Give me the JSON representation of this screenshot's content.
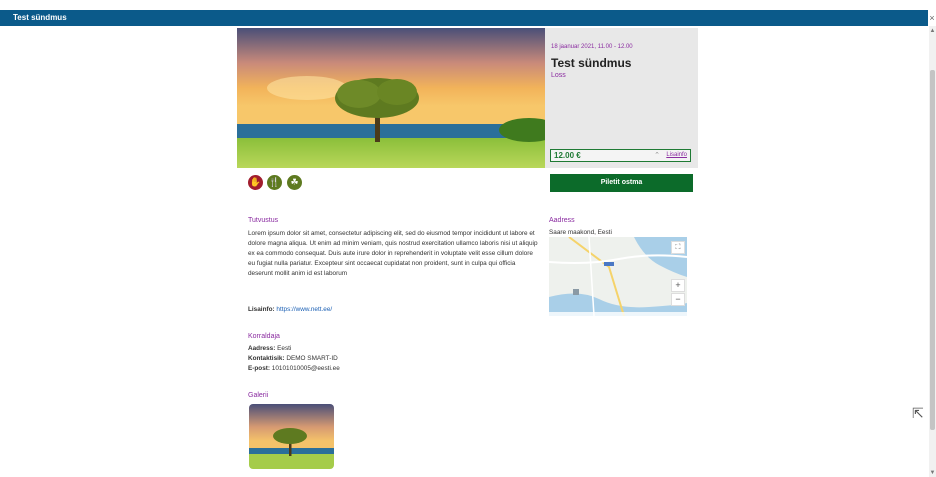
{
  "window": {
    "title": "Test sündmus",
    "close_label": "×"
  },
  "event": {
    "date": "18 jaanuar 2021, 11.00 - 12.00",
    "title": "Test sündmus",
    "location": "Loss",
    "price": "12.00 €",
    "more_info_label": "Lisainfo",
    "buy_label": "Piletit ostma"
  },
  "description": {
    "heading": "Tutvustus",
    "text": "Lorem ipsum dolor sit amet, consectetur adipiscing elit, sed do eiusmod tempor incididunt ut labore et dolore magna aliqua. Ut enim ad minim veniam, quis nostrud exercitation ullamco laboris nisi ut aliquip ex ea commodo consequat. Duis aute irure dolor in reprehenderit in voluptate velit esse cillum dolore eu fugiat nulla pariatur. Excepteur sint occaecat cupidatat non proident, sunt in culpa qui officia deserunt mollit anim id est laborum",
    "extra_label": "Lisainfo:",
    "extra_link": "https://www.nett.ee/"
  },
  "address": {
    "heading": "Aadress",
    "text": "Saare maakond, Eesti"
  },
  "organizer": {
    "heading": "Korraldaja",
    "address_label": "Aadress:",
    "address_value": "Eesti",
    "contact_label": "Kontaktisik:",
    "contact_value": "DEMO SMART-ID",
    "email_label": "E-post:",
    "email_value": "10101010005@eesti.ee"
  },
  "gallery": {
    "heading": "Galerii"
  },
  "map": {
    "zoom_in": "+",
    "zoom_out": "−",
    "fullscreen": "⛶"
  },
  "colors": {
    "accent": "#8a2ba0",
    "header": "#0b5a8a",
    "buy": "#0c6b2a"
  }
}
